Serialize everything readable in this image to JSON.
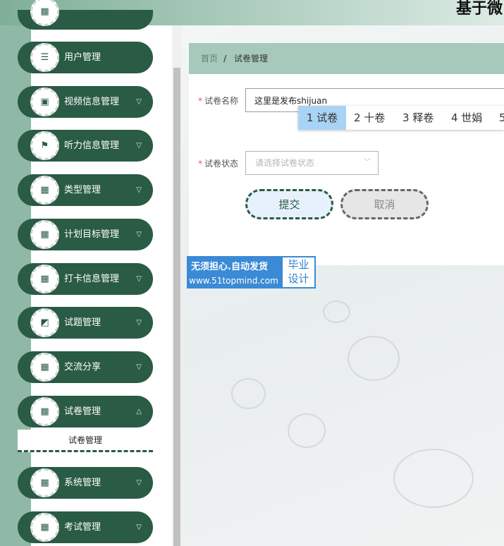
{
  "header": {
    "site_title": "基于微"
  },
  "sidebar": {
    "items": [
      {
        "label": "用户管理",
        "icon": "list-icon"
      },
      {
        "label": "视频信息管理",
        "icon": "video-icon"
      },
      {
        "label": "听力信息管理",
        "icon": "flag-icon"
      },
      {
        "label": "类型管理",
        "icon": "grid-icon"
      },
      {
        "label": "计划目标管理",
        "icon": "grid-icon"
      },
      {
        "label": "打卡信息管理",
        "icon": "grid-icon"
      },
      {
        "label": "试题管理",
        "icon": "chart-icon"
      },
      {
        "label": "交流分享",
        "icon": "grid-icon"
      },
      {
        "label": "试卷管理",
        "icon": "grid-icon"
      },
      {
        "label": "系统管理",
        "icon": "grid-icon"
      },
      {
        "label": "考试管理",
        "icon": "grid-icon"
      }
    ],
    "submenu_item": "试卷管理"
  },
  "breadcrumb": {
    "home": "首页",
    "separator": "/",
    "current": "试卷管理"
  },
  "form": {
    "name_label": "试卷名称",
    "name_value": "这里是发布shijuan",
    "status_label": "试卷状态",
    "status_placeholder": "请选择试卷状态",
    "required_mark": "*"
  },
  "ime": {
    "candidates": [
      "1 试卷",
      "2 十卷",
      "3 释卷",
      "4 世娟",
      "5"
    ]
  },
  "buttons": {
    "submit": "提交",
    "cancel": "取消"
  },
  "watermark": {
    "line1": "无须担心.自动发货",
    "line2": "www.51topmind.com",
    "badge_line1": "毕业",
    "badge_line2": "设计"
  }
}
